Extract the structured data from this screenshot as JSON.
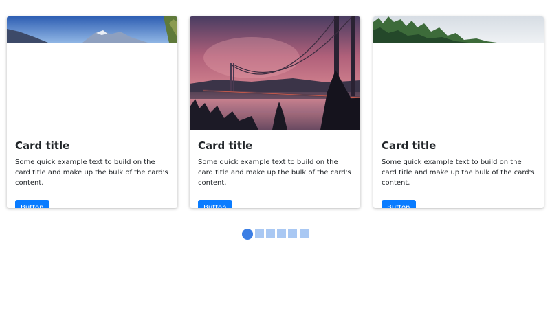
{
  "cards": [
    {
      "title": "Card title",
      "text": "Some quick example text to build on the card title and make up the bulk of the card's content.",
      "button_label": "Button",
      "image": "mountain-landscape-image"
    },
    {
      "title": "Card title",
      "text": "Some quick example text to build on the card title and make up the bulk of the card's content.",
      "button_label": "Button",
      "image": "suspension-bridge-sunset-image"
    },
    {
      "title": "Card title",
      "text": "Some quick example text to build on the card title and make up the bulk of the card's content.",
      "button_label": "Button",
      "image": "forest-treeline-image"
    }
  ],
  "pagination": {
    "count": 6,
    "active_index": 0
  },
  "colors": {
    "button": "#0a7cff",
    "dot_active": "#3b7ee4",
    "dot_inactive": "#a9c8f3"
  }
}
